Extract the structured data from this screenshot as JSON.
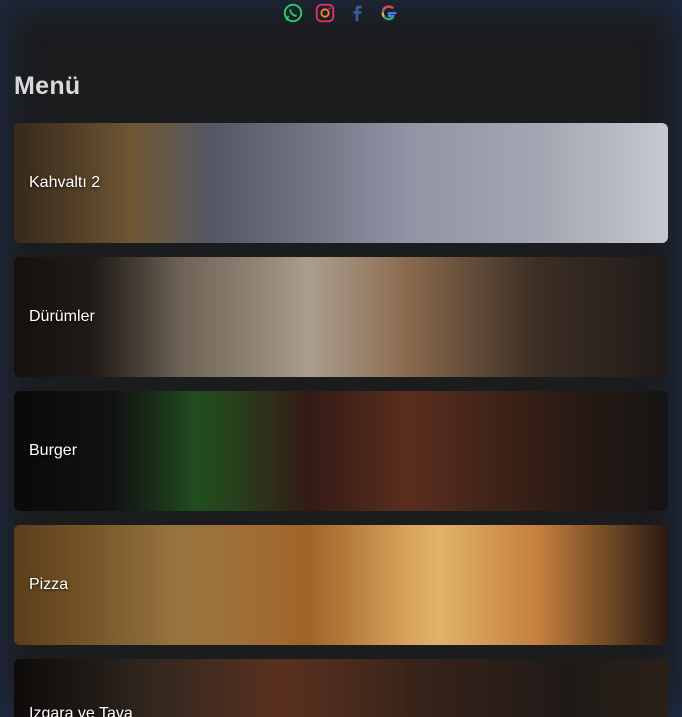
{
  "social": {
    "icons": [
      "whatsapp-icon",
      "instagram-icon",
      "facebook-icon",
      "google-icon"
    ],
    "colors": {
      "whatsapp": "#25d366",
      "instagram": "#e1306c",
      "facebook": "#3b5998",
      "google": "#4285f4"
    }
  },
  "menu": {
    "title": "Menü",
    "categories": [
      {
        "label": "Kahvaltı 2"
      },
      {
        "label": "Dürümler"
      },
      {
        "label": "Burger"
      },
      {
        "label": "Pizza"
      },
      {
        "label": "Izgara ve Tava"
      }
    ]
  },
  "theme": {
    "background": "#1b1c1e",
    "title_color": "#d9d9d9"
  }
}
